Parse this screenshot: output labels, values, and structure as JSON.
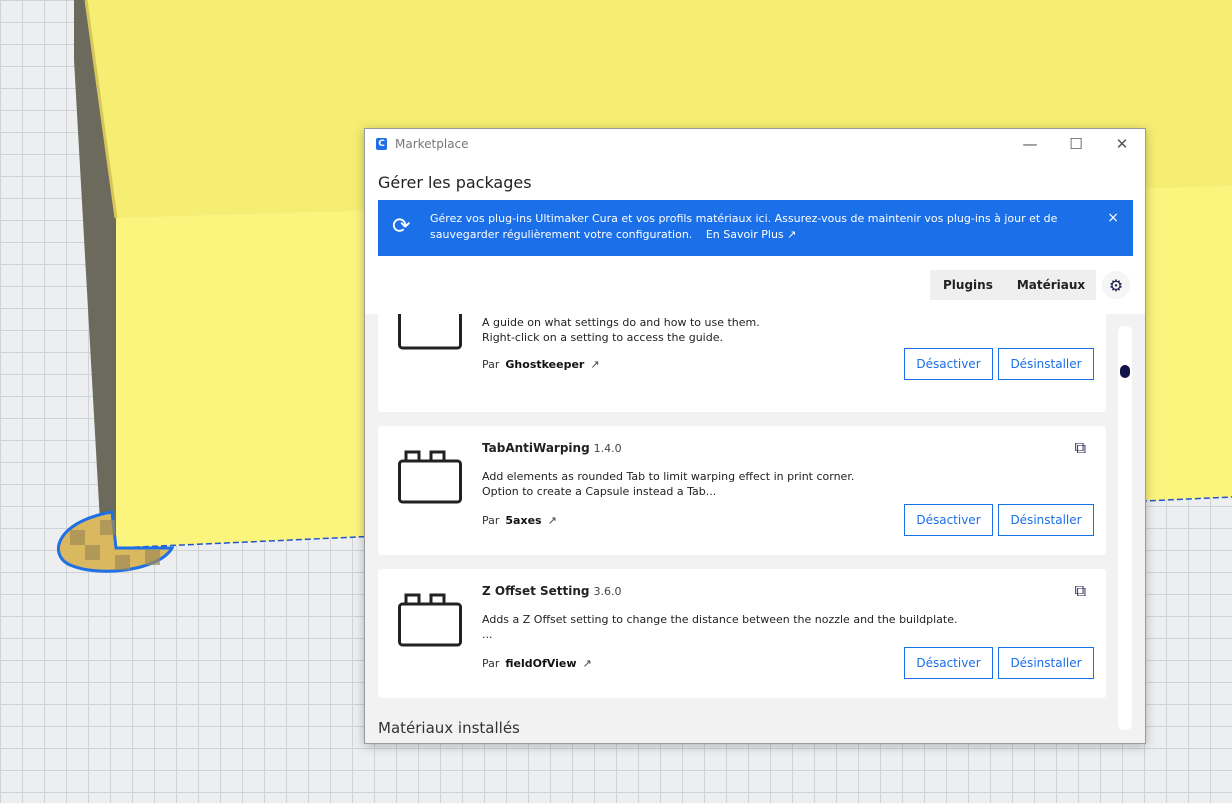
{
  "window": {
    "title": "Marketplace",
    "app_icon_letter": "C"
  },
  "header": {
    "title": "Gérer les packages"
  },
  "banner": {
    "text": "Gérez vos plug-ins Ultimaker Cura et vos profils matériaux ici. Assurez-vous de maintenir vos plug-ins à jour et de sauvegarder régulièrement votre configuration.",
    "link": "En Savoir Plus",
    "close": "×"
  },
  "tabs": [
    {
      "label": "Plugins"
    },
    {
      "label": "Matériaux"
    }
  ],
  "by_label": "Par",
  "plugins": [
    {
      "name": "",
      "version": "",
      "desc1": "A guide on what settings do and how to use them.",
      "desc2": "Right-click on a setting to access the guide.",
      "author": "Ghostkeeper",
      "disable": "Désactiver",
      "uninstall": "Désinstaller"
    },
    {
      "name": "TabAntiWarping",
      "version": "1.4.0",
      "desc1": "Add elements as rounded Tab to limit warping effect in print corner.",
      "desc2": "Option to create a Capsule instead a Tab...",
      "author": "5axes",
      "disable": "Désactiver",
      "uninstall": "Désinstaller"
    },
    {
      "name": "Z Offset Setting",
      "version": "3.6.0",
      "desc1": "Adds a Z Offset setting to change the distance between the nozzle and the buildplate.",
      "desc2": "...",
      "author": "fieldOfView",
      "disable": "Désactiver",
      "uninstall": "Désinstaller"
    }
  ],
  "section_title": "Matériaux installés",
  "scroll_position": 0.1,
  "colors": {
    "accent": "#1b6fe8",
    "model": "#f8f07a"
  }
}
